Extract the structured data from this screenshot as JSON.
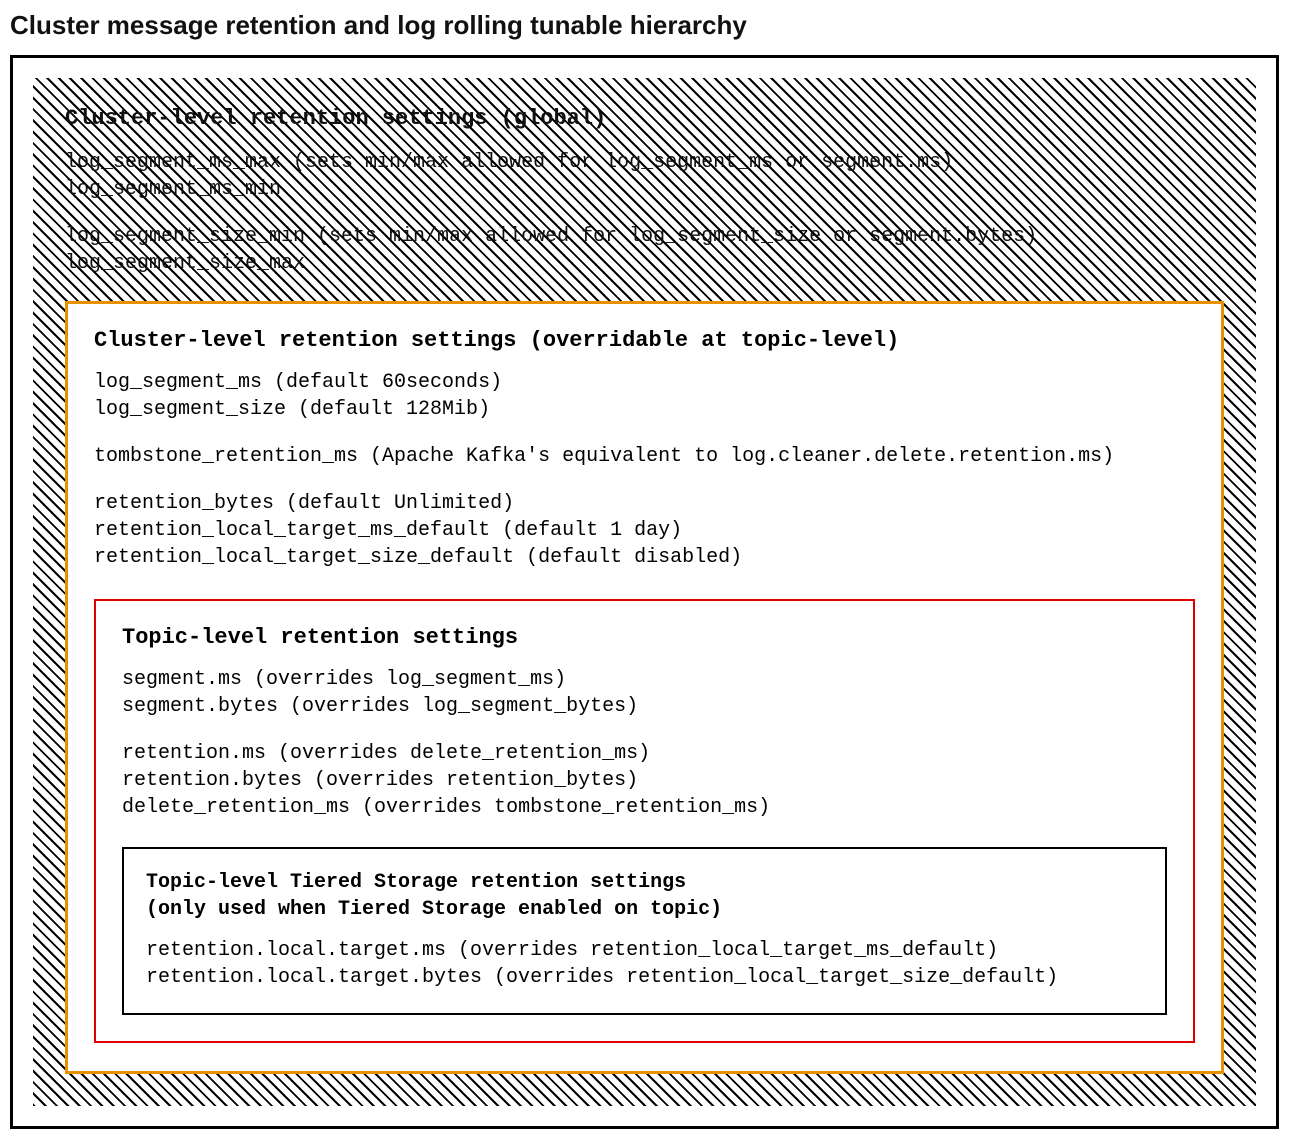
{
  "page_title": "Cluster message retention and log rolling tunable hierarchy",
  "global": {
    "title": "Cluster-level retention settings (global)",
    "line1": "log_segment_ms_max (sets min/max allowed for log_segment_ms or segment.ms)",
    "line2": "log_segment_ms_min",
    "line3": "log_segment_size_min (sets min/max allowed for log_segment_size or segment.bytes)",
    "line4": "log_segment_size_max"
  },
  "cluster": {
    "title": "Cluster-level retention settings (overridable at topic-level)",
    "line1": "log_segment_ms (default 60seconds)",
    "line2": "log_segment_size (default 128Mib)",
    "line3": "tombstone_retention_ms (Apache Kafka's equivalent to log.cleaner.delete.retention.ms)",
    "line4": "retention_bytes (default Unlimited)",
    "line5": "retention_local_target_ms_default (default 1 day)",
    "line6": "retention_local_target_size_default (default disabled)"
  },
  "topic": {
    "title": "Topic-level retention settings",
    "line1": "segment.ms (overrides log_segment_ms)",
    "line2": "segment.bytes (overrides log_segment_bytes)",
    "line3": "retention.ms (overrides delete_retention_ms)",
    "line4": "retention.bytes (overrides retention_bytes)",
    "line5": "delete_retention_ms (overrides tombstone_retention_ms)"
  },
  "tiered": {
    "title1": "Topic-level Tiered Storage retention settings",
    "title2": "(only used when Tiered Storage enabled on topic)",
    "line1": "retention.local.target.ms (overrides retention_local_target_ms_default)",
    "line2": "retention.local.target.bytes (overrides retention_local_target_size_default)"
  }
}
